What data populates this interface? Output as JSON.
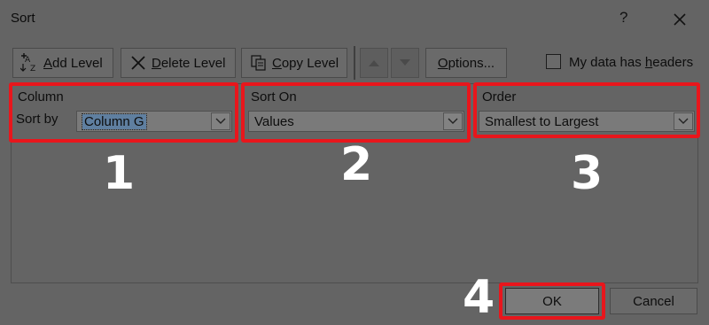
{
  "window": {
    "title": "Sort",
    "help_label": "?"
  },
  "toolbar": {
    "add_level": {
      "underlined": "A",
      "rest": "dd Level"
    },
    "delete_level": {
      "underlined": "D",
      "rest": "elete Level"
    },
    "copy_level": {
      "underlined": "C",
      "rest": "opy Level"
    },
    "options": {
      "underlined": "O",
      "rest": "ptions..."
    },
    "headers_checkbox": {
      "prefix": "My data has ",
      "underlined": "h",
      "rest": "eaders",
      "checked": false
    }
  },
  "columns": {
    "column": {
      "header": "Column",
      "row_label": "Sort by",
      "value": "Column G"
    },
    "sort_on": {
      "header": "Sort On",
      "value": "Values"
    },
    "order": {
      "header": "Order",
      "value": "Smallest to Largest"
    }
  },
  "footer": {
    "ok_label": "OK",
    "cancel_label": "Cancel"
  },
  "callouts": {
    "n1": "1",
    "n2": "2",
    "n3": "3",
    "n4": "4"
  },
  "colors": {
    "callout_border": "#e8161c",
    "dim_background": "#646464",
    "callout_text": "#ffffff"
  },
  "icons": [
    "add-level-icon",
    "delete-level-icon",
    "copy-level-icon",
    "move-up-icon",
    "move-down-icon",
    "close-icon",
    "chevron-down-icon"
  ]
}
